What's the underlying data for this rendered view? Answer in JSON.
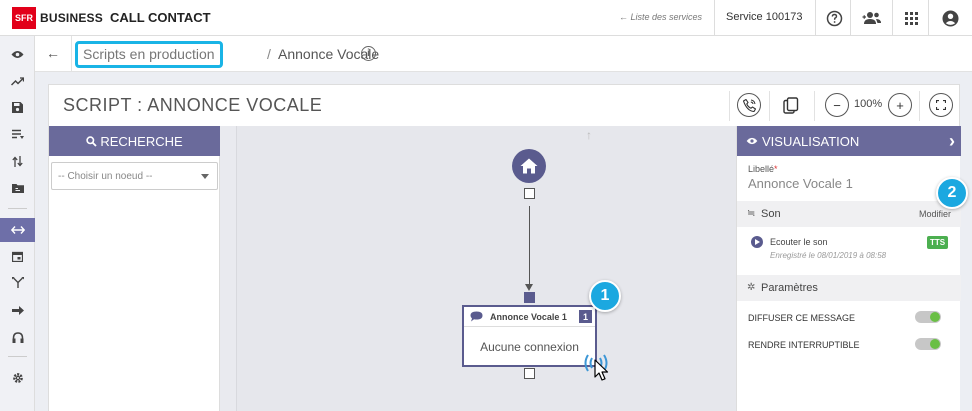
{
  "topbar": {
    "logo_text": "SFR",
    "brand": "BUSINESS",
    "app_title": "CALL CONTACT",
    "services_link": "← Liste des services",
    "service_name": "Service 100173",
    "icons": [
      "help-icon",
      "users-icon",
      "apps-grid-icon",
      "account-icon"
    ]
  },
  "sidebar": {
    "items": [
      "eye-icon",
      "trending-icon",
      "save-icon",
      "list-icon",
      "sort-icon",
      "folder-icon",
      "scripts-icon",
      "calendar-icon",
      "routing-icon",
      "forward-icon",
      "headset-icon",
      "settings-icon"
    ],
    "active": "scripts-icon"
  },
  "breadcrumb": {
    "back": "←",
    "parent": "Scripts en production",
    "separator": "/",
    "current": "Annonce Vocale",
    "info": "i"
  },
  "card": {
    "title": "SCRIPT : ANNONCE VOCALE",
    "zoom": "100%",
    "zoom_out": "−",
    "zoom_in": "+"
  },
  "search": {
    "header": "RECHERCHE",
    "select_placeholder": "-- Choisir un noeud --"
  },
  "canvas": {
    "up_arrow": "↑",
    "node": {
      "title": "Annonce Vocale 1",
      "badge": "1",
      "body": "Aucune connexion"
    },
    "callouts": [
      "1",
      "2"
    ]
  },
  "visualisation": {
    "header": "VISUALISATION",
    "collapse": "›",
    "libelle_label": "Libellé",
    "libelle_required": "*",
    "libelle_value": "Annonce Vocale 1",
    "son_section": "Son",
    "modifier": "Modifier",
    "sound_title": "Ecouter le son",
    "sound_date": "Enregistré le 08/01/2019 à 08:58",
    "tts": "TTS",
    "params_section": "Paramètres",
    "options": [
      {
        "label": "DIFFUSER CE MESSAGE",
        "on": true
      },
      {
        "label": "RENDRE INTERRUPTIBLE",
        "on": true
      }
    ]
  },
  "colors": {
    "brand_red": "#e2001a",
    "panel_purple": "#6a6a9b",
    "accent_blue": "#1ba8e0",
    "toggle_green": "#6abf45",
    "tts_green": "#4caf50"
  }
}
